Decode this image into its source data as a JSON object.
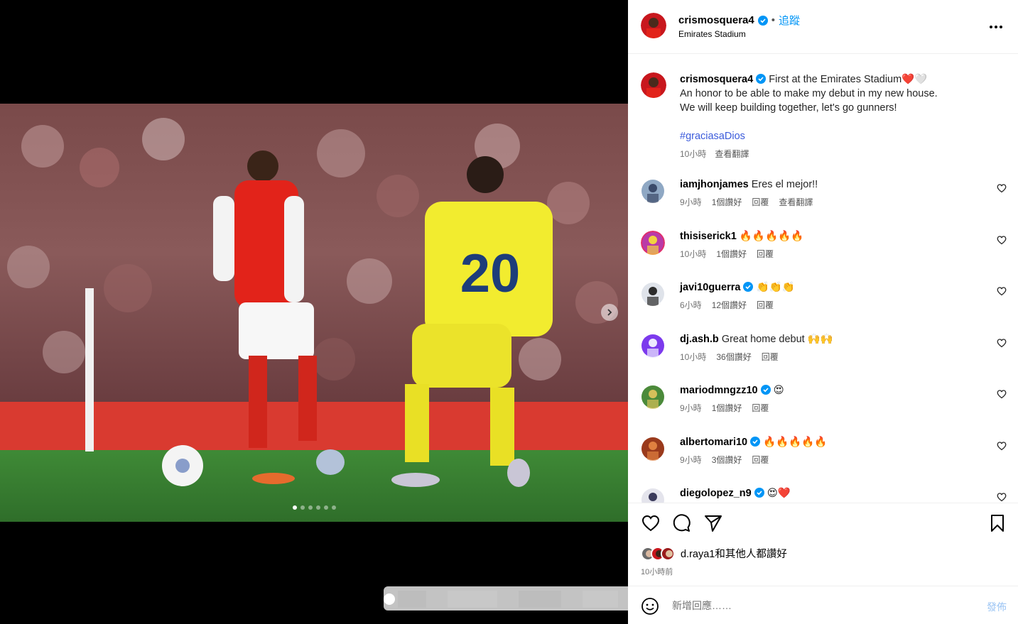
{
  "header": {
    "username": "crismosquera4",
    "follow_label": "追蹤",
    "location": "Emirates Stadium"
  },
  "caption": {
    "username": "crismosquera4",
    "line1": "First at the Emirates Stadium❤️🤍",
    "line2": "An honor to be able to make my debut in my new house.",
    "line3": "We will keep building together, let's go gunners!",
    "hashtag": "#graciasaDios",
    "time": "10小時",
    "translate_label": "查看翻譯"
  },
  "comments": [
    {
      "username": "iamjhonjames",
      "verified": false,
      "text": "Eres el mejor!!",
      "time": "9小時",
      "likes": "1個讚好",
      "reply": "回覆",
      "translate": "查看翻譯"
    },
    {
      "username": "thisiserick1",
      "verified": false,
      "text": "🔥🔥🔥🔥🔥",
      "time": "10小時",
      "likes": "1個讚好",
      "reply": "回覆"
    },
    {
      "username": "javi10guerra",
      "verified": true,
      "text": "👏👏👏",
      "time": "6小時",
      "likes": "12個讚好",
      "reply": "回覆"
    },
    {
      "username": "dj.ash.b",
      "verified": false,
      "text": "Great home debut 🙌🙌",
      "time": "10小時",
      "likes": "36個讚好",
      "reply": "回覆"
    },
    {
      "username": "mariodmngzz10",
      "verified": true,
      "text": "😍",
      "time": "9小時",
      "likes": "1個讚好",
      "reply": "回覆"
    },
    {
      "username": "albertomari10",
      "verified": true,
      "text": "🔥🔥🔥🔥🔥",
      "time": "9小時",
      "likes": "3個讚好",
      "reply": "回覆"
    },
    {
      "username": "diegolopez_n9",
      "verified": true,
      "text": "😍❤️",
      "time": "",
      "likes": "",
      "reply": ""
    }
  ],
  "likes": {
    "text": "d.raya1和其他人都讚好",
    "post_time": "10小時前"
  },
  "add_comment": {
    "placeholder": "新增回應……",
    "post_label": "發佈"
  },
  "carousel": {
    "slide_count": 6,
    "active_index": 0
  },
  "icons": {
    "verified": "verified-badge-icon",
    "like": "heart-icon",
    "comment": "comment-icon",
    "share": "share-icon",
    "save": "bookmark-icon",
    "emoji": "emoji-icon",
    "more": "more-options-icon",
    "next": "chevron-right-icon"
  },
  "colors": {
    "link_blue": "#0095f6",
    "verified_blue": "#0095f6",
    "arsenal_red": "#e2231a",
    "away_yellow": "#f2ec2f"
  }
}
